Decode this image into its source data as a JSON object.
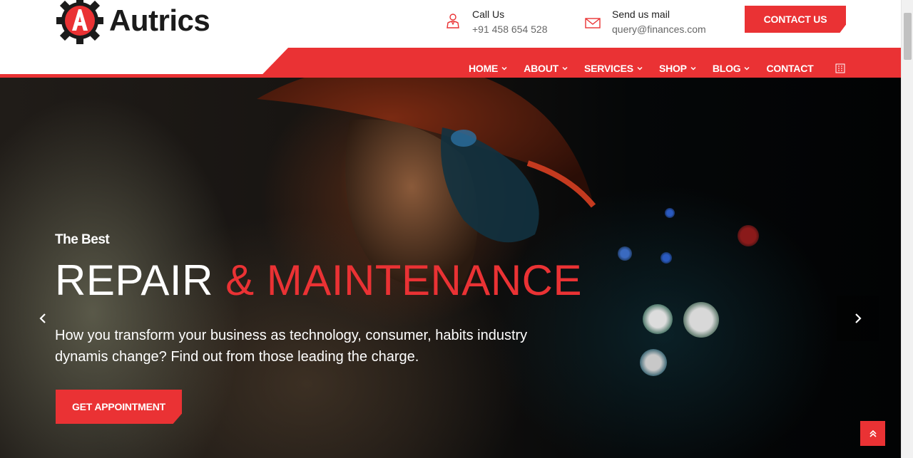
{
  "brand": {
    "name": "Autrics",
    "accent_color": "#ea3234",
    "logo_icon": "gear-a-logo-icon"
  },
  "header": {
    "call": {
      "title": "Call Us",
      "value": "+91 458 654 528",
      "icon": "user-icon"
    },
    "mail": {
      "title": "Send us mail",
      "value": "query@finances.com",
      "icon": "mail-icon"
    },
    "contact_button": "CONTACT US"
  },
  "nav": {
    "items": [
      {
        "label": "HOME",
        "dropdown": true
      },
      {
        "label": "ABOUT",
        "dropdown": true
      },
      {
        "label": "SERVICES",
        "dropdown": true
      },
      {
        "label": "SHOP",
        "dropdown": true
      },
      {
        "label": "BLOG",
        "dropdown": true
      },
      {
        "label": "CONTACT",
        "dropdown": false
      }
    ],
    "extra_icon": "grid-icon"
  },
  "hero": {
    "subtitle": "The Best",
    "title_white": "REPAIR",
    "title_red": "& MAINTENANCE",
    "description": "How you transform your business as technology, consumer, habits industry dynamis change? Find out from those leading the charge.",
    "button": "GET APPOINTMENT",
    "prev_icon": "chevron-left-icon",
    "next_icon": "chevron-right-icon"
  },
  "scroll_top_icon": "double-chevron-up-icon"
}
